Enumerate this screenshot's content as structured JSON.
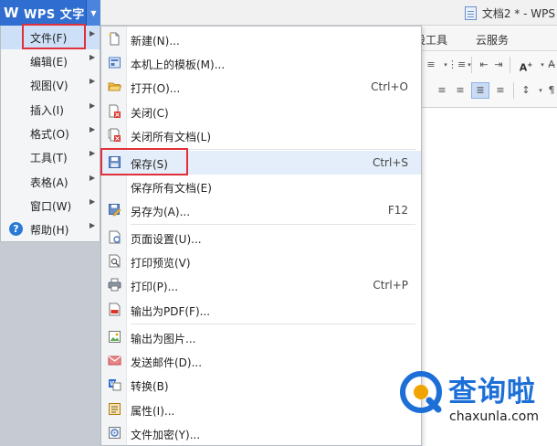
{
  "app": {
    "name": "WPS 文字",
    "document_title": "文档2 * - WPS"
  },
  "ribbon_tabs": [
    "设工具",
    "云服务"
  ],
  "main_menu": {
    "items": [
      {
        "label": "文件(F)",
        "has_submenu": true,
        "selected": true
      },
      {
        "label": "编辑(E)",
        "has_submenu": true
      },
      {
        "label": "视图(V)",
        "has_submenu": true
      },
      {
        "label": "插入(I)",
        "has_submenu": true
      },
      {
        "label": "格式(O)",
        "has_submenu": true
      },
      {
        "label": "工具(T)",
        "has_submenu": true
      },
      {
        "label": "表格(A)",
        "has_submenu": true
      },
      {
        "label": "窗口(W)",
        "has_submenu": true
      },
      {
        "label": "帮助(H)",
        "has_submenu": true,
        "icon": "help-icon"
      }
    ]
  },
  "file_menu": {
    "items": [
      {
        "label": "新建(N)...",
        "shortcut": "",
        "icon": "new-document-icon"
      },
      {
        "label": "本机上的模板(M)...",
        "shortcut": "",
        "icon": "template-icon"
      },
      {
        "label": "打开(O)...",
        "shortcut": "Ctrl+O",
        "icon": "open-folder-icon"
      },
      {
        "label": "关闭(C)",
        "shortcut": "",
        "icon": "close-document-icon"
      },
      {
        "label": "关闭所有文档(L)",
        "shortcut": "",
        "icon": "close-all-icon"
      },
      {
        "label": "保存(S)",
        "shortcut": "Ctrl+S",
        "icon": "save-icon",
        "highlighted": true
      },
      {
        "label": "保存所有文档(E)",
        "shortcut": "",
        "icon": ""
      },
      {
        "label": "另存为(A)...",
        "shortcut": "F12",
        "icon": "save-as-icon"
      },
      {
        "label": "页面设置(U)...",
        "shortcut": "",
        "icon": "page-setup-icon"
      },
      {
        "label": "打印预览(V)",
        "shortcut": "",
        "icon": "print-preview-icon"
      },
      {
        "label": "打印(P)...",
        "shortcut": "Ctrl+P",
        "icon": "print-icon"
      },
      {
        "label": "输出为PDF(F)...",
        "shortcut": "",
        "icon": "pdf-icon"
      },
      {
        "label": "输出为图片...",
        "shortcut": "",
        "icon": "image-export-icon"
      },
      {
        "label": "发送邮件(D)...",
        "shortcut": "",
        "icon": "mail-icon"
      },
      {
        "label": "转换(B)",
        "shortcut": "",
        "icon": "convert-icon"
      },
      {
        "label": "属性(I)...",
        "shortcut": "",
        "icon": "properties-icon"
      },
      {
        "label": "文件加密(Y)...",
        "shortcut": "",
        "icon": "encrypt-icon"
      }
    ]
  },
  "watermark": {
    "brand": "查询啦",
    "url": "chaxunla.com"
  },
  "colors": {
    "accent": "#2f6dd0",
    "highlight": "#e0303a",
    "watermark": "#1d6fd8"
  }
}
